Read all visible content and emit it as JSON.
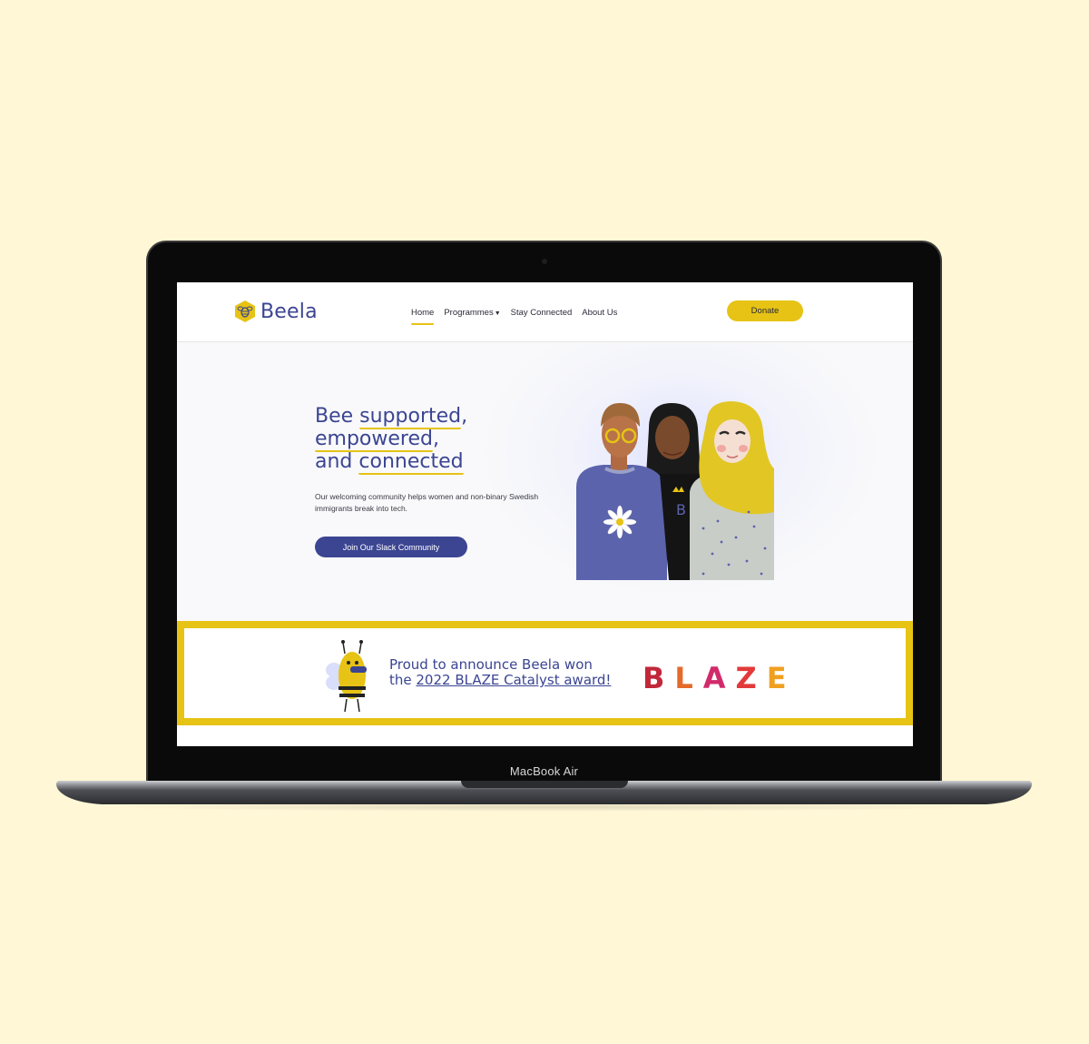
{
  "device": {
    "label": "MacBook Air"
  },
  "brand": {
    "name": "Beela",
    "primary": "#3b4592",
    "accent": "#e6c315"
  },
  "nav": {
    "items": [
      {
        "label": "Home",
        "active": true
      },
      {
        "label": "Programmes",
        "dropdown": true
      },
      {
        "label": "Stay Connected"
      },
      {
        "label": "About Us"
      }
    ],
    "donate_label": "Donate"
  },
  "hero": {
    "line1_pre": "Bee ",
    "line1_underlined": "supported",
    "line1_post": ",",
    "line2_underlined": "empowered",
    "line2_post": ",",
    "line3_pre": "and ",
    "line3_underlined": "connected",
    "description": "Our welcoming community helps women and non-binary Swedish immigrants break into tech.",
    "cta_label": "Join Our Slack Community"
  },
  "banner": {
    "line1": "Proud to announce Beela won",
    "line2_pre": "the ",
    "link_text": "2022 BLAZE Catalyst award!",
    "blaze_letters": [
      "B",
      "L",
      "A",
      "Z",
      "E"
    ]
  }
}
